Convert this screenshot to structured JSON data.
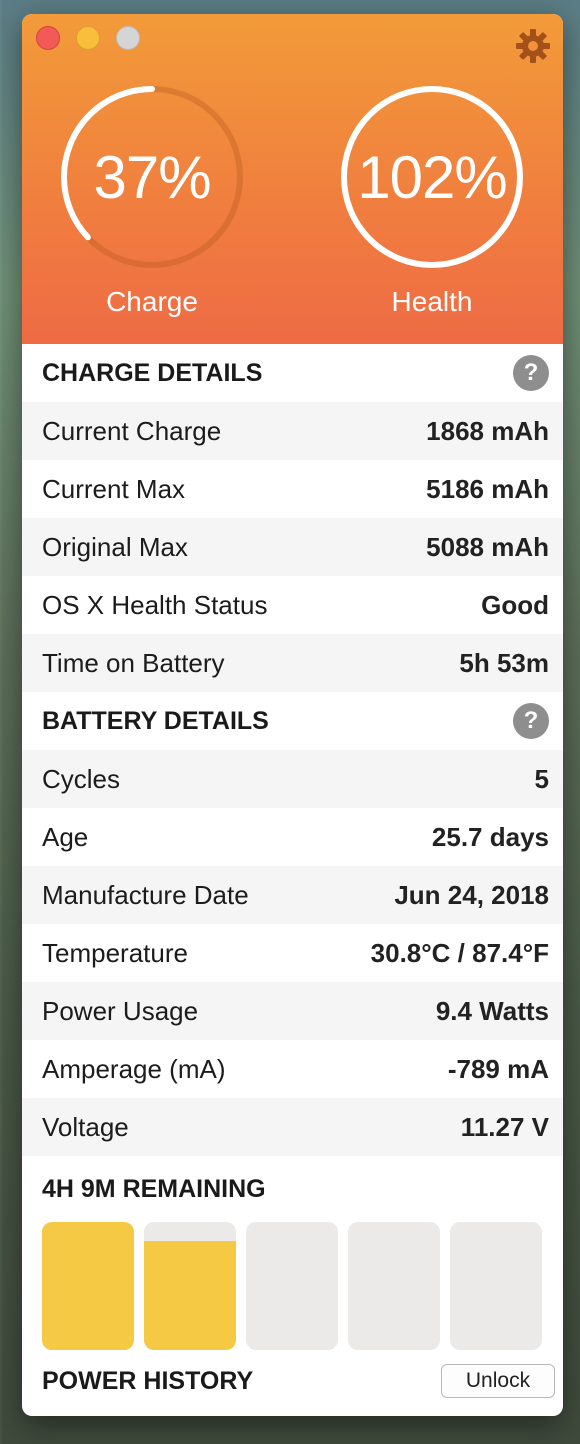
{
  "header": {
    "charge": {
      "value": "37%",
      "label": "Charge",
      "fraction": 0.37
    },
    "health": {
      "value": "102%",
      "label": "Health",
      "fraction": 1.0
    }
  },
  "charge_details": {
    "title": "CHARGE DETAILS",
    "help": "?",
    "rows": [
      {
        "label": "Current Charge",
        "value": "1868 mAh"
      },
      {
        "label": "Current Max",
        "value": "5186 mAh"
      },
      {
        "label": "Original Max",
        "value": "5088 mAh"
      },
      {
        "label": "OS X Health Status",
        "value": "Good"
      },
      {
        "label": "Time on Battery",
        "value": "5h 53m"
      }
    ]
  },
  "battery_details": {
    "title": "BATTERY DETAILS",
    "help": "?",
    "rows": [
      {
        "label": "Cycles",
        "value": "5"
      },
      {
        "label": "Age",
        "value": "25.7 days"
      },
      {
        "label": "Manufacture Date",
        "value": "Jun 24, 2018"
      },
      {
        "label": "Temperature",
        "value": "30.8°C / 87.4°F"
      },
      {
        "label": "Power Usage",
        "value": "9.4 Watts"
      },
      {
        "label": "Amperage (mA)",
        "value": "-789 mA"
      },
      {
        "label": "Voltage",
        "value": "11.27 V"
      }
    ]
  },
  "remaining": {
    "title": "4H 9M REMAINING",
    "bars": [
      1.0,
      0.85,
      0,
      0,
      0
    ]
  },
  "power_history": {
    "title": "POWER HISTORY",
    "unlock_label": "Unlock"
  },
  "colors": {
    "header_top": "#f29b39",
    "header_bottom": "#ee6b45",
    "bar_fill": "#f6c944",
    "bar_empty": "#ebeae8",
    "help_badge": "#8e8e8e"
  }
}
